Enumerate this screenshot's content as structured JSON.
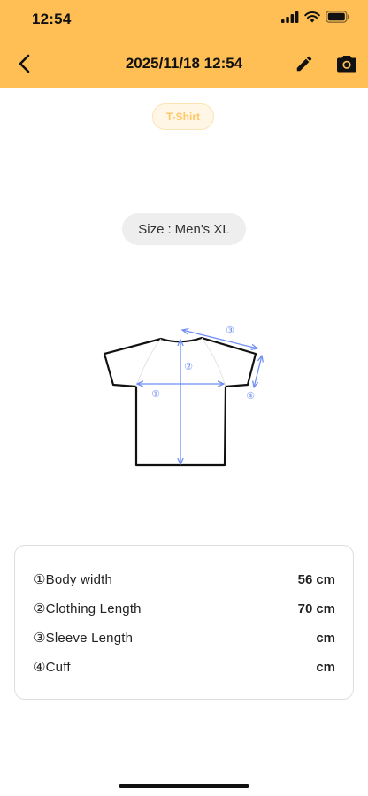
{
  "status_bar": {
    "time": "12:54",
    "icons": [
      "signal-icon",
      "wifi-icon",
      "battery-icon"
    ]
  },
  "nav": {
    "title": "2025/11/18 12:54",
    "back_icon": "chevron-left-icon",
    "edit_icon": "pencil-icon",
    "camera_icon": "camera-icon"
  },
  "category": {
    "label": "T-Shirt"
  },
  "size": {
    "label": "Size",
    "separator": ":",
    "value": "Men's XL"
  },
  "diagram": {
    "markers": [
      "①",
      "②",
      "③",
      "④"
    ],
    "accent_color": "#6f8ef5"
  },
  "measurements": [
    {
      "label": "①Body width",
      "value": "56",
      "unit": "cm"
    },
    {
      "label": "②Clothing Length",
      "value": "70",
      "unit": "cm"
    },
    {
      "label": "③Sleeve Length",
      "value": "",
      "unit": "cm"
    },
    {
      "label": "④Cuff",
      "value": "",
      "unit": "cm"
    }
  ],
  "colors": {
    "header_bg": "#ffbf55",
    "badge_text": "#ffc766",
    "chip_bg": "#eeeeee"
  }
}
